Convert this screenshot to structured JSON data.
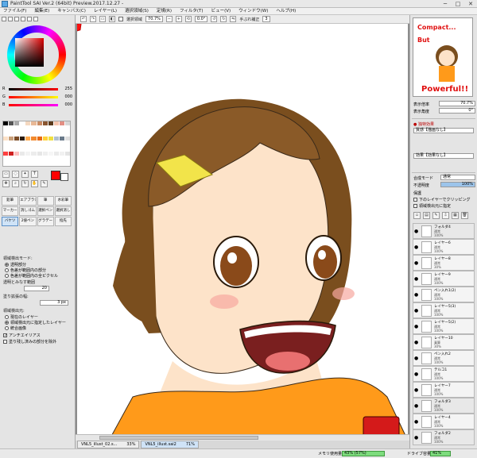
{
  "window": {
    "title": "PaintTool SAI Ver.2 (64bit) Preview.2017.12.27 -",
    "minimize": "─",
    "maximize": "□",
    "close": "✕"
  },
  "menu": [
    "ファイル(F)",
    "編集(E)",
    "キャンバス(C)",
    "レイヤー(L)",
    "選択領域(S)",
    "定規(R)",
    "フィルタ(T)",
    "ビュー(V)",
    "ウィンドウ(W)",
    "ヘルプ(H)"
  ],
  "toolbar": {
    "selection_label": "選択領域",
    "zoom": "70.7%",
    "rotation": "0.0°",
    "stabilizer_label": "手ぶれ補正",
    "stabilizer_value": "3"
  },
  "color": {
    "r_label": "R",
    "r_value": "255",
    "g_label": "G",
    "g_value": "000",
    "b_label": "B",
    "b_value": "000",
    "fg": "#ff0000",
    "bg": "#ffffff"
  },
  "tools": {
    "brush_labels": [
      "鉛筆",
      "エアブラシ",
      "筆",
      "水彩筆",
      "マーカー",
      "消しゴム",
      "選択ペン",
      "選択消し",
      "バケツ",
      "2値ペン",
      "グラデー",
      "指先"
    ]
  },
  "tool_options": {
    "detect_mode_label": "領域検出モード:",
    "detect_options": [
      "透明部分",
      "色差が範囲内の部分",
      "色差が範囲内の全ピクセル"
    ],
    "tolerance_label": "透明とみなす範囲",
    "tolerance_value": "20",
    "expand_label": "塗り拡張の幅:",
    "expand_value": "3 px",
    "source_label": "領域検出元:",
    "source_options": [
      "現在のレイヤー",
      "領域検出元に指定したレイヤー",
      "統合画像"
    ],
    "antialias_label": "アンチエイリアス",
    "fill_gap_label": "塗り残し済みの部分を除外"
  },
  "navigator": {
    "zoom_label": "表示倍率",
    "zoom_value": "70.7%",
    "angle_label": "表示角度",
    "angle_value": "0°",
    "preview_texts": [
      "Compact...",
      "But",
      "Powerful!!"
    ]
  },
  "layer_props": {
    "effects_label": "● 独特効果",
    "texture_label": "質感【描画なし】",
    "effect_label": "効果【効果なし】",
    "blend_label": "合成モード",
    "blend_value": "通常",
    "opacity_label": "不透明度",
    "opacity_value": "100%",
    "protect_label": "保護",
    "clip_label": "下のレイヤーでクリッピング",
    "detect_src_label": "領域検出元に指定"
  },
  "layers": [
    {
      "name": "フォルダ4",
      "mode": "通常",
      "opacity": "100%",
      "type": "folder"
    },
    {
      "name": "レイヤー6",
      "mode": "通常",
      "opacity": "100%",
      "type": "layer"
    },
    {
      "name": "レイヤー8",
      "mode": "通常",
      "opacity": "30%",
      "type": "layer"
    },
    {
      "name": "レイヤー9",
      "mode": "通常",
      "opacity": "100%",
      "type": "layer"
    },
    {
      "name": "ペン入れ1(2)",
      "mode": "通常",
      "opacity": "100%",
      "type": "layer"
    },
    {
      "name": "レイヤー5(3)",
      "mode": "通常",
      "opacity": "100%",
      "type": "layer"
    },
    {
      "name": "レイヤー5(2)",
      "mode": "通常",
      "opacity": "100%",
      "type": "layer"
    },
    {
      "name": "レイヤー10",
      "mode": "乗算",
      "opacity": "30%",
      "type": "layer"
    },
    {
      "name": "ペン入れ2",
      "mode": "通常",
      "opacity": "100%",
      "type": "layer"
    },
    {
      "name": "テルコ1",
      "mode": "通常",
      "opacity": "100%",
      "type": "layer"
    },
    {
      "name": "レイヤー7",
      "mode": "通常",
      "opacity": "100%",
      "type": "layer"
    },
    {
      "name": "フォルダ3",
      "mode": "通常",
      "opacity": "100%",
      "type": "folder"
    },
    {
      "name": "レイヤー4",
      "mode": "通常",
      "opacity": "100%",
      "type": "layer"
    },
    {
      "name": "フォルダ2",
      "mode": "通常",
      "opacity": "100%",
      "type": "folder"
    },
    {
      "name": "フォルダ1",
      "mode": "通常",
      "opacity": "100%",
      "type": "folder"
    }
  ],
  "tabs": [
    {
      "name": "VNL5_illust_02.s...",
      "zoom": "33%"
    },
    {
      "name": "VNL5_illust.sai2",
      "zoom": "71%"
    }
  ],
  "status": {
    "memory_label": "メモリ使用量",
    "memory_value": "43% (57%)",
    "drive_label": "ドライブ容量",
    "drive_value": "41%"
  },
  "canvas_text": "Ɔd∃7..."
}
